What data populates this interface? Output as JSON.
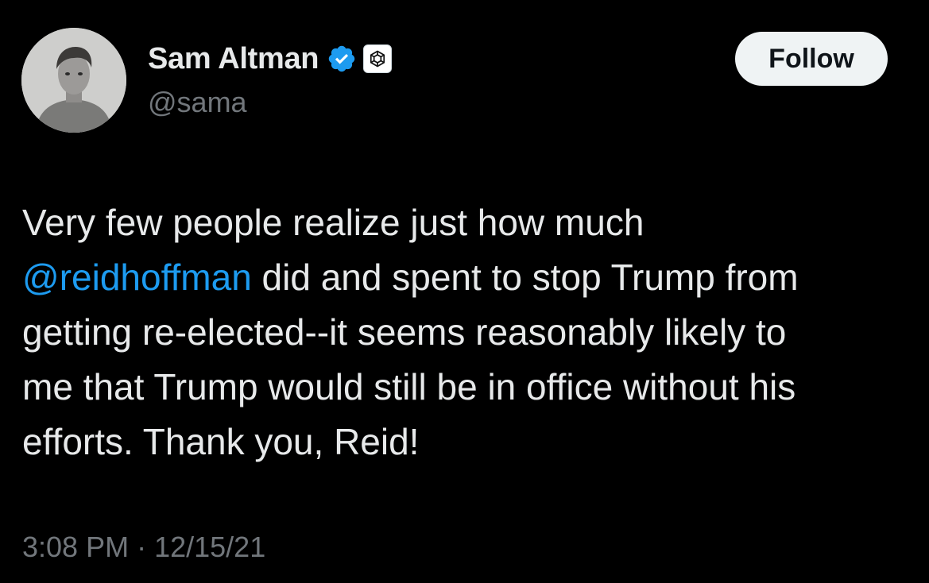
{
  "author": {
    "display_name": "Sam Altman",
    "handle": "@sama",
    "verified_icon": "verified-badge-icon",
    "affiliate_icon": "openai-logo-icon"
  },
  "follow_label": "Follow",
  "tweet": {
    "line1": "Very few people realize just how much",
    "mention": "@reidhoffman",
    "line2_rest": " did and spent to stop Trump from",
    "line3": "getting re-elected--it seems reasonably likely to",
    "line4": "me that Trump would still be in office without his",
    "line5": "efforts. Thank you, Reid!"
  },
  "meta": {
    "time": "3:08 PM",
    "separator": "·",
    "date": "12/15/21"
  },
  "colors": {
    "background": "#000000",
    "text": "#e7e9ea",
    "secondary": "#71767b",
    "link": "#1d9bf0",
    "verified": "#1d9bf0",
    "button_bg": "#eff3f4"
  }
}
